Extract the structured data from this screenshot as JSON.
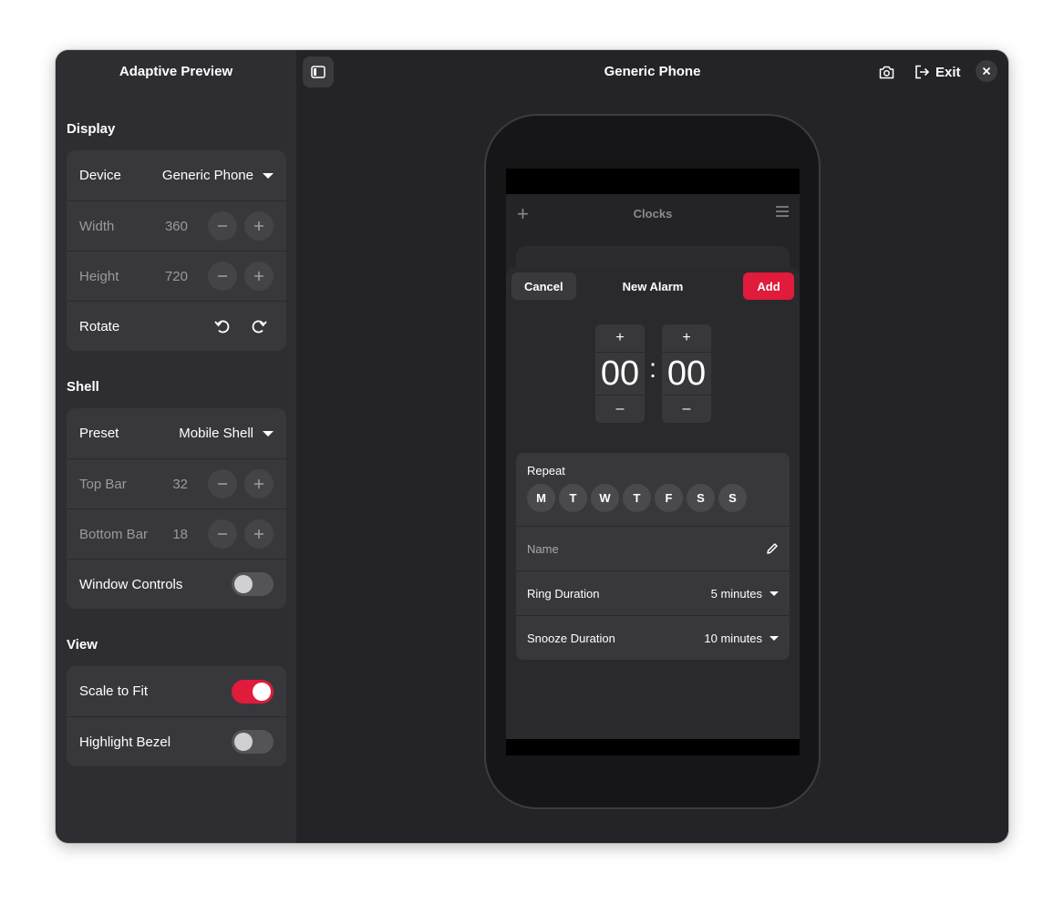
{
  "sidebar": {
    "title": "Adaptive Preview",
    "display": {
      "title": "Display",
      "device_label": "Device",
      "device_value": "Generic Phone",
      "width_label": "Width",
      "width_value": "360",
      "height_label": "Height",
      "height_value": "720",
      "rotate_label": "Rotate"
    },
    "shell": {
      "title": "Shell",
      "preset_label": "Preset",
      "preset_value": "Mobile Shell",
      "top_bar_label": "Top Bar",
      "top_bar_value": "32",
      "bottom_bar_label": "Bottom Bar",
      "bottom_bar_value": "18",
      "window_controls_label": "Window Controls",
      "window_controls_on": false
    },
    "view": {
      "title": "View",
      "scale_to_fit_label": "Scale to Fit",
      "scale_to_fit_on": true,
      "highlight_bezel_label": "Highlight Bezel",
      "highlight_bezel_on": false
    }
  },
  "header": {
    "title": "Generic Phone",
    "exit_label": "Exit"
  },
  "phone_app": {
    "title": "Clocks",
    "dialog": {
      "title": "New Alarm",
      "cancel_label": "Cancel",
      "add_label": "Add",
      "hours": "00",
      "minutes": "00",
      "separator": ":",
      "plus": "+",
      "minus": "–",
      "repeat_label": "Repeat",
      "days": [
        "M",
        "T",
        "W",
        "T",
        "F",
        "S",
        "S"
      ],
      "name_placeholder": "Name",
      "ring_duration_label": "Ring Duration",
      "ring_duration_value": "5 minutes",
      "snooze_duration_label": "Snooze Duration",
      "snooze_duration_value": "10 minutes"
    }
  },
  "colors": {
    "accent": "#e01b3c",
    "window_bg": "#242428",
    "sidebar_bg": "#2e2e32"
  }
}
